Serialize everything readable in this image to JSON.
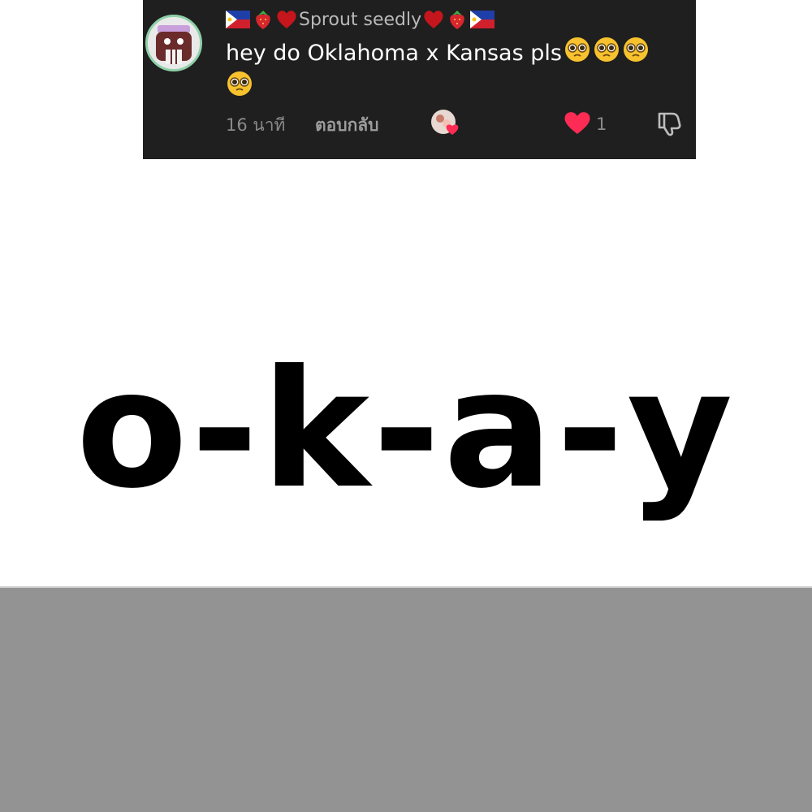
{
  "comment": {
    "username": "Sprout seedly",
    "username_decoration_icons": [
      "philippines-flag-icon",
      "strawberry-icon",
      "red-heart-icon"
    ],
    "text": "hey do Oklahoma x Kansas pls",
    "text_emoji": "pleading-face-icon",
    "text_emoji_count": 4,
    "timestamp": "16 นาที",
    "reply_label": "ตอบกลับ",
    "like_count": "1",
    "like_color": "#fe2c55",
    "card_background": "#1f1f1f"
  },
  "overlay": {
    "word": "o-k-a-y"
  },
  "bottom_band_color": "#939393"
}
